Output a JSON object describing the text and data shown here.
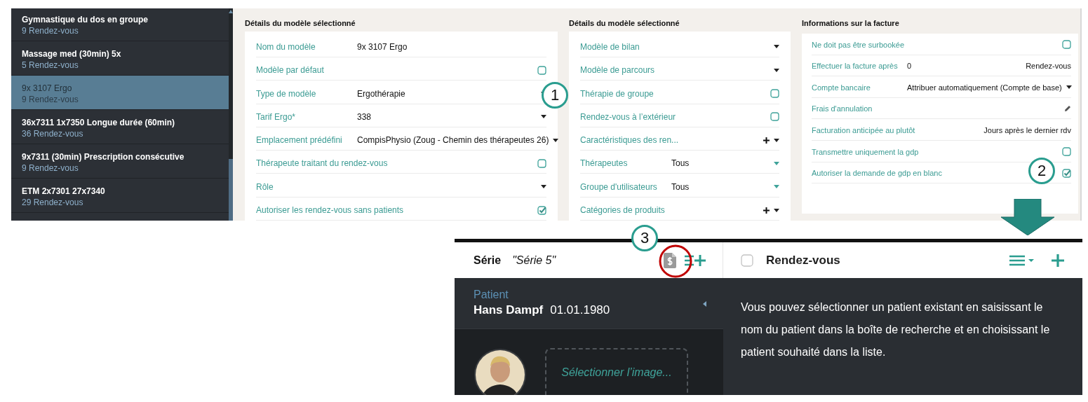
{
  "template_list": [
    {
      "name": "Gymnastique du dos en groupe",
      "count": "9 Rendez-vous",
      "selected": false
    },
    {
      "name": "Massage med (30min) 5x",
      "count": "5 Rendez-vous",
      "selected": false
    },
    {
      "name": "9x 3107 Ergo",
      "count": "9 Rendez-vous",
      "selected": true
    },
    {
      "name": "36x7311 1x7350 Longue durée (60min)",
      "count": "36 Rendez-vous",
      "selected": false
    },
    {
      "name": "9x7311 (30min) Prescription consécutive",
      "count": "9 Rendez-vous",
      "selected": false
    },
    {
      "name": "ETM 2x7301 27x7340",
      "count": "29 Rendez-vous",
      "selected": false
    }
  ],
  "template_details": {
    "title": "Détails du modèle sélectionné",
    "rows": [
      {
        "kind": "text",
        "label": "Nom du modèle",
        "value": "9x 3107 Ergo"
      },
      {
        "kind": "checkbox",
        "label": "Modèle par défaut",
        "checked": false
      },
      {
        "kind": "select",
        "label": "Type de modèle",
        "value": "Ergothérapie"
      },
      {
        "kind": "select",
        "label": "Tarif Ergo*",
        "value": "338"
      },
      {
        "kind": "select",
        "label": "Emplacement prédéfini",
        "value": "CompisPhysio (Zoug - Chemin des thérapeutes 26)"
      },
      {
        "kind": "checkbox",
        "label": "Thérapeute traitant du rendez-vous",
        "checked": false
      },
      {
        "kind": "select",
        "label": "Rôle"
      },
      {
        "kind": "checkbox",
        "label": "Autoriser les rendez-vous sans patients",
        "checked": true
      }
    ]
  },
  "template_details_more": {
    "title": "Détails du modèle sélectionné",
    "rows": [
      {
        "kind": "select",
        "label": "Modèle de bilan"
      },
      {
        "kind": "select",
        "label": "Modèle de parcours"
      },
      {
        "kind": "checkbox",
        "label": "Thérapie de groupe",
        "checked": false
      },
      {
        "kind": "checkbox",
        "label": "Rendez-vous à l’extérieur",
        "checked": false
      },
      {
        "kind": "add-select",
        "label": "Caractéristiques des ren..."
      },
      {
        "kind": "multi-select",
        "label": "Thérapeutes",
        "value": "Tous"
      },
      {
        "kind": "multi-select",
        "label": "Groupe d'utilisateurs",
        "value": "Tous"
      },
      {
        "kind": "add-select",
        "label": "Catégories de produits"
      }
    ]
  },
  "invoice": {
    "title": "Informations sur la facture",
    "rows": [
      {
        "kind": "checkbox",
        "label": "Ne doit pas être surbookée",
        "checked": false
      },
      {
        "kind": "value-suffix",
        "label": "Effectuer la facture après",
        "value": "0",
        "suffix": "Rendez-vous"
      },
      {
        "kind": "select",
        "label": "Compte bancaire",
        "value": "Attribuer automatiquement (Compte de base)"
      },
      {
        "kind": "edit",
        "label": "Frais d'annulation"
      },
      {
        "kind": "value-right",
        "label": "Facturation anticipée au plutôt",
        "value": "Jours après le dernier rdv"
      },
      {
        "kind": "checkbox",
        "label": "Transmettre uniquement la gdp",
        "checked": false
      },
      {
        "kind": "checkbox",
        "label": "Autoriser la demande de gdp en blanc",
        "checked": true
      }
    ]
  },
  "series_panel": {
    "label": "Série",
    "name": "\"Série 5\"",
    "patient_label": "Patient",
    "patient_name": "Hans Dampf",
    "birth_date": "01.01.1980",
    "image_placeholder": "Sélectionner l’image..."
  },
  "appointments_panel": {
    "checked": false,
    "title": "Rendez-vous",
    "help_text": "Vous pouvez sélectionner un patient existant en saisissant le nom du patient dans la boîte de recherche et en choisissant le patient souhaité dans la liste."
  },
  "annotations": [
    {
      "label": "1"
    },
    {
      "label": "2"
    },
    {
      "label": "3"
    }
  ]
}
